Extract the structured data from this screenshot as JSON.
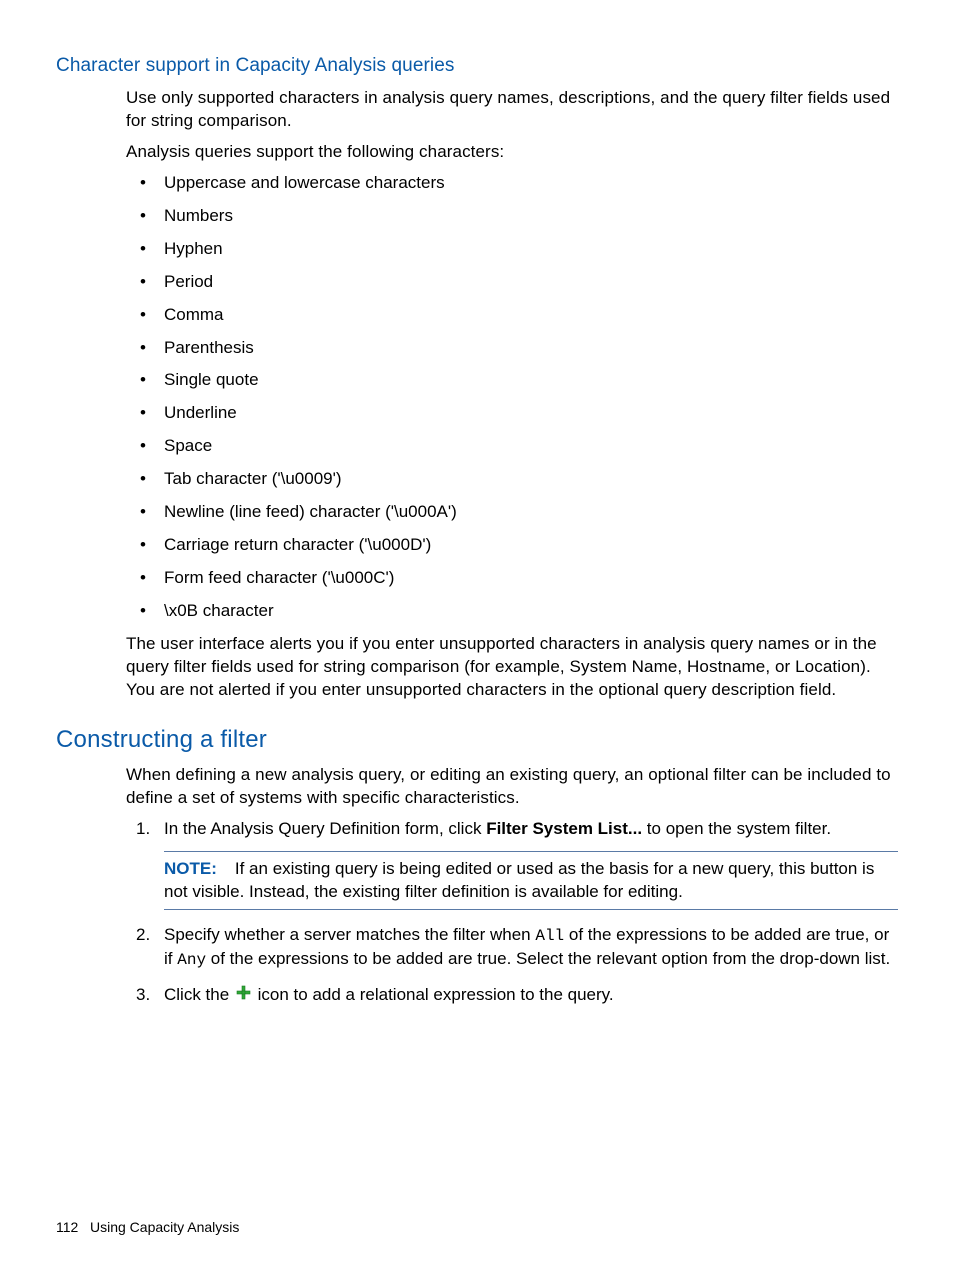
{
  "section1": {
    "heading": "Character support in Capacity Analysis queries",
    "p1": "Use only supported characters in analysis query names, descriptions, and the query filter fields used for string comparison.",
    "p2": "Analysis queries support the following characters:",
    "bullets": [
      "Uppercase and lowercase characters",
      "Numbers",
      "Hyphen",
      "Period",
      "Comma",
      "Parenthesis",
      "Single quote",
      "Underline",
      "Space",
      "Tab character ('\\u0009')",
      "Newline (line feed) character ('\\u000A')",
      "Carriage return character ('\\u000D')",
      "Form feed character ('\\u000C')",
      "\\x0B character"
    ],
    "p3": "The user interface alerts you if you enter unsupported characters in analysis query names or in the query filter fields used for string comparison (for example, System Name, Hostname, or Location). You are not alerted if you enter unsupported characters in the optional query description field."
  },
  "section2": {
    "heading": "Constructing a filter",
    "p1": "When defining a new analysis query, or editing an existing query, an optional filter can be included to define a set of systems with specific characteristics.",
    "step1_a": "In the Analysis Query Definition form, click ",
    "step1_bold": "Filter System List...",
    "step1_b": " to open the system filter.",
    "note_label": "NOTE:",
    "note_text": "If an existing query is being edited or used as the basis for a new query, this button is not visible. Instead, the existing filter definition is available for editing.",
    "step2_a": "Specify whether a server matches the filter when ",
    "step2_all": "All",
    "step2_b": " of the expressions to be added are true, or if ",
    "step2_any": "Any",
    "step2_c": " of the expressions to be added are true. Select the relevant option from the drop-down list.",
    "step3_a": "Click the ",
    "step3_b": " icon to add a relational expression to the query."
  },
  "footer": {
    "page_number": "112",
    "chapter": "Using Capacity Analysis"
  }
}
